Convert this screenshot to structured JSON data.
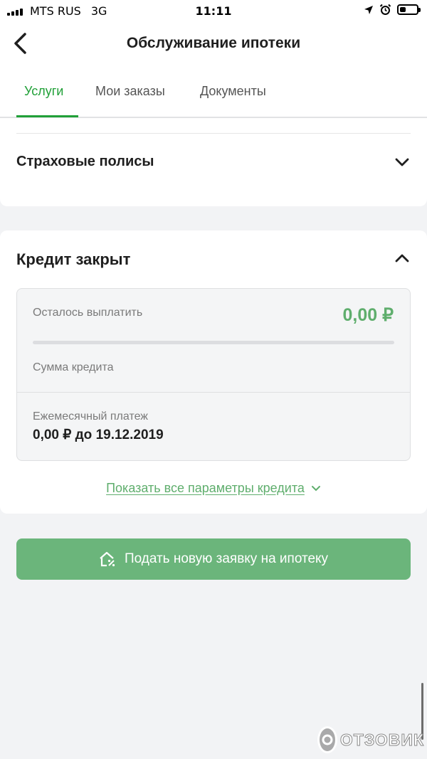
{
  "status_bar": {
    "carrier": "MTS RUS",
    "network": "3G",
    "time": "11:11",
    "battery_level": 0.35,
    "icons": [
      "signal-icon",
      "location-arrow-icon",
      "alarm-icon",
      "battery-icon"
    ]
  },
  "header": {
    "title": "Обслуживание ипотеки",
    "back_icon": "back-chevron-icon",
    "tabs": [
      {
        "label": "Услуги",
        "active": true
      },
      {
        "label": "Мои заказы",
        "active": false
      },
      {
        "label": "Документы",
        "active": false
      }
    ]
  },
  "insurance": {
    "title": "Страховые полисы",
    "icon": "chevron-down-icon"
  },
  "credit": {
    "title": "Кредит закрыт",
    "icon": "chevron-up-icon",
    "remaining_label": "Осталось выплатить",
    "remaining_value": "0,00 ₽",
    "repaid_fraction": 0,
    "loan_amount_label": "Сумма кредита",
    "monthly_label": "Ежемесячный платеж",
    "monthly_value": "0,00 ₽ до 19.12.2019",
    "show_all_link": "Показать все параметры кредита"
  },
  "apply_button": {
    "label": "Подать новую заявку на ипотеку",
    "icon": "house-percent-icon"
  },
  "watermark": {
    "text": "ОТЗОВИК"
  },
  "colors": {
    "accent": "#21a038",
    "button": "#6bb57b",
    "amount": "#5fae6d",
    "background": "#f2f3f5"
  }
}
